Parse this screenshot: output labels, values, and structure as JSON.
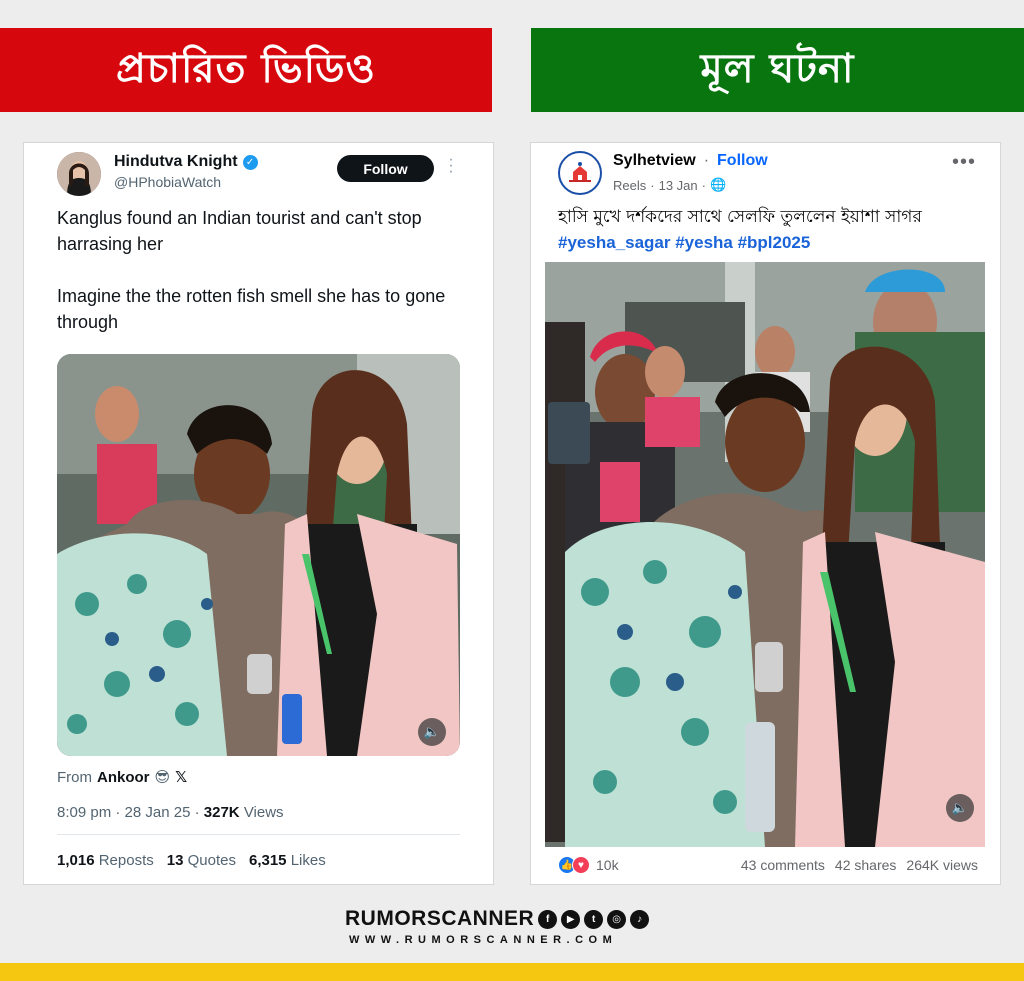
{
  "banners": {
    "left": "প্রচারিত ভিডিও",
    "right": "মূল ঘটনা"
  },
  "tweet": {
    "name": "Hindutva Knight",
    "handle": "@HPhobiaWatch",
    "follow_label": "Follow",
    "text_line1": "Kanglus found an Indian tourist and can't stop harrasing her",
    "text_line2": "Imagine the the rotten fish smell she has to gone through",
    "from_label": "From",
    "from_name": "Ankoor",
    "from_emoji": "😎",
    "from_x": "𝕏",
    "time": "8:09 pm",
    "date": "28 Jan 25",
    "views_count": "327K",
    "views_label": "Views",
    "reposts_count": "1,016",
    "reposts_label": "Reposts",
    "quotes_count": "13",
    "quotes_label": "Quotes",
    "likes_count": "6,315",
    "likes_label": "Likes"
  },
  "facebook": {
    "page_name": "Sylhetview",
    "follow_label": "Follow",
    "sub_type": "Reels",
    "sub_date": "13 Jan",
    "caption": "হাসি মুখে দর্শকদের সাথে সেলফি তুললেন ইয়াশা সাগর",
    "hashtags": "#yesha_sagar #yesha #bpl2025",
    "reactions_count": "10k",
    "comments": "43 comments",
    "shares": "42 shares",
    "views": "264K views"
  },
  "brand": {
    "name": "RUMORSCANNER",
    "url": "WWW.RUMORSCANNER.COM"
  },
  "icons": {
    "verified": "verified-badge-icon",
    "globe": "globe-icon",
    "sound": "speaker-icon"
  },
  "colors": {
    "banner_left": "#d7080d",
    "banner_right": "#08750f",
    "twitter_blue": "#1d9bf0",
    "facebook_blue": "#0866ff",
    "bottom_bar": "#f5c710"
  }
}
